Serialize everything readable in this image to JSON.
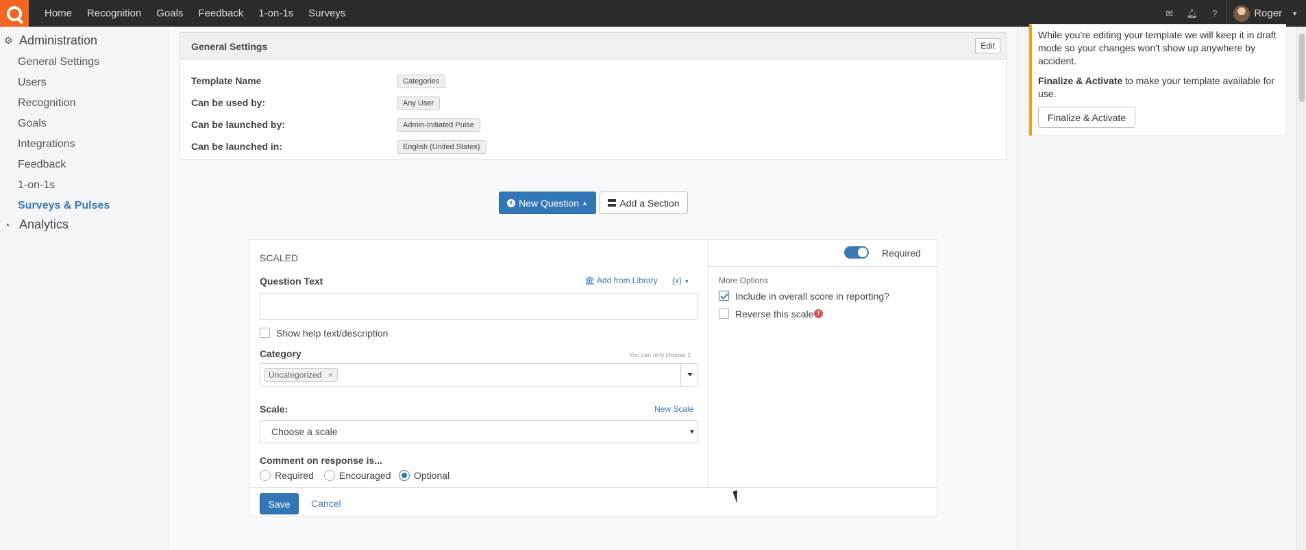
{
  "nav": {
    "links": [
      "Home",
      "Recognition",
      "Goals",
      "Feedback",
      "1-on-1s",
      "Surveys"
    ],
    "icons": [
      "envelope-icon",
      "bell-icon",
      "question-icon"
    ],
    "user_name": "Roger",
    "brand_color": "#f26522"
  },
  "sidebar": {
    "admin_title": "Administration",
    "items": [
      "General Settings",
      "Users",
      "Recognition",
      "Goals",
      "Integrations",
      "Feedback",
      "1-on-1s",
      "Surveys & Pulses"
    ],
    "active_item": "Surveys & Pulses",
    "analytics_title": "Analytics"
  },
  "general_settings": {
    "title": "General Settings",
    "edit_label": "Edit",
    "rows": [
      {
        "label": "Template Name",
        "value": "Categories"
      },
      {
        "label": "Can be used by:",
        "value": "Any User"
      },
      {
        "label": "Can be launched by:",
        "value": "Admin-Initiated Pulse"
      },
      {
        "label": "Can be launched in:",
        "value": "English (United States)"
      }
    ]
  },
  "actions": {
    "new_question": "New Question",
    "add_section": "Add a Section"
  },
  "question": {
    "type_label": "SCALED",
    "question_text_label": "Question Text",
    "add_from_library": "Add from Library",
    "variables": "{x}",
    "question_text_value": "",
    "show_help_label": "Show help text/description",
    "category_label": "Category",
    "category_hint": "You can only choose 1",
    "category_chip": "Uncategorized",
    "chip_remove": "×",
    "scale_label": "Scale:",
    "new_scale": "New Scale",
    "scale_placeholder": "Choose a scale",
    "comment_label": "Comment on response is...",
    "comment_options": [
      "Required",
      "Encouraged",
      "Optional"
    ],
    "comment_selected": "Optional",
    "required_label": "Required",
    "required_on": true,
    "more_options_label": "More Options",
    "include_score_label": "Include in overall score in reporting?",
    "include_score_checked": true,
    "reverse_scale_label": "Reverse this scale",
    "reverse_scale_checked": false,
    "save_label": "Save",
    "cancel_label": "Cancel"
  },
  "notice": {
    "line1": "While you're editing your template we will keep it in draft mode so your changes won't show up anywhere by accident.",
    "finalize_bold": "Finalize & Activate",
    "finalize_rest": " to make your template available for use.",
    "finalize_button": "Finalize & Activate",
    "accent": "#e8a317"
  }
}
